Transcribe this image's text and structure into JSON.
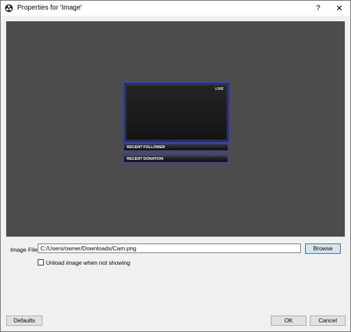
{
  "window": {
    "title": "Properties for 'Image'",
    "help_symbol": "?",
    "close_symbol": "✕"
  },
  "preview": {
    "live_text": "LIVE",
    "bar1_text": "RECENT FOLLOWER",
    "bar2_text": "RECENT DONATION",
    "accent_color": "#2a3cd6"
  },
  "image_file": {
    "label": "Image File",
    "value": "C:/Users/owner/Downloads/Cam.png",
    "browse_label": "Browse"
  },
  "unload_checkbox": {
    "label": "Unload image when not showing",
    "checked": false
  },
  "footer": {
    "defaults_label": "Defaults",
    "ok_label": "OK",
    "cancel_label": "Cancel"
  }
}
